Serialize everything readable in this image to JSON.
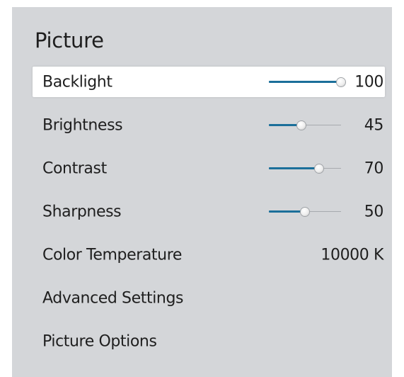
{
  "menu": {
    "title": "Picture",
    "items": [
      {
        "label": "Backlight",
        "value": "100",
        "level": 100,
        "focused": true
      },
      {
        "label": "Brightness",
        "value": "45",
        "level": 45,
        "focused": false
      },
      {
        "label": "Contrast",
        "value": "70",
        "level": 70,
        "focused": false
      },
      {
        "label": "Sharpness",
        "value": "50",
        "level": 50,
        "focused": false
      },
      {
        "label": "Color Temperature",
        "value": "10000 K"
      },
      {
        "label": "Advanced Settings"
      },
      {
        "label": "Picture Options"
      }
    ]
  },
  "colors": {
    "panel_background": "#d4d6d9",
    "focus_background": "#ffffff",
    "slider_fill": "#1b6f9a",
    "text": "#1e1e1e"
  }
}
